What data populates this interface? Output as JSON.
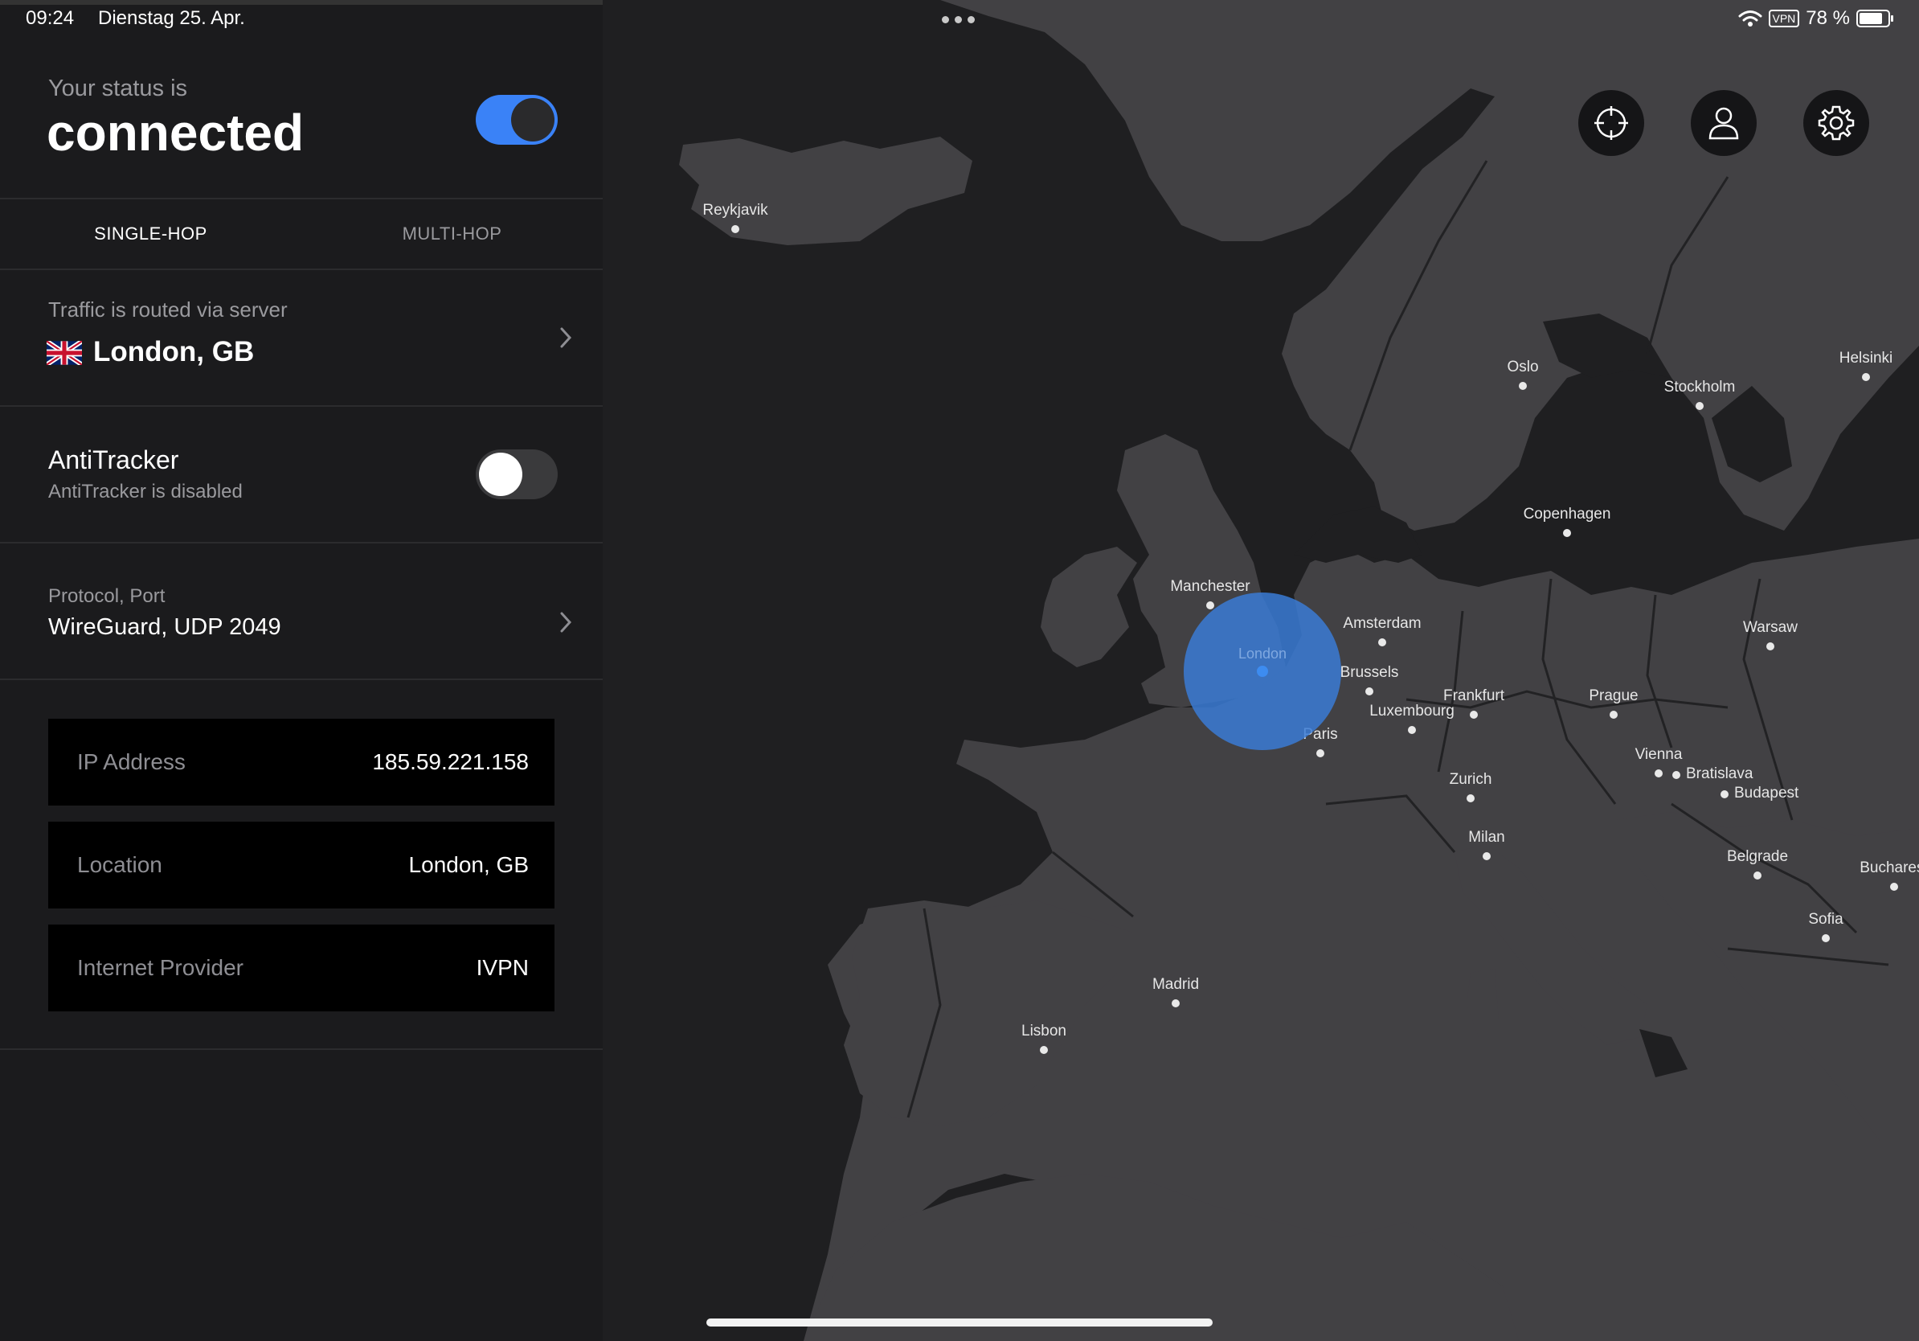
{
  "status_bar": {
    "time": "09:24",
    "date": "Dienstag 25. Apr.",
    "vpn": "VPN",
    "battery": "78 %",
    "icons": [
      "wifi-icon",
      "vpn-badge",
      "battery-icon"
    ]
  },
  "header": {
    "status_label": "Your status is",
    "status_value": "connected",
    "connection_toggle": "on"
  },
  "tabs": [
    {
      "label": "SINGLE-HOP",
      "selected": true
    },
    {
      "label": "MULTI-HOP",
      "selected": false
    }
  ],
  "server": {
    "label": "Traffic is routed via server",
    "value": "London, GB",
    "flag": "uk-flag-icon"
  },
  "antitracker": {
    "title": "AntiTracker",
    "subtitle": "AntiTracker is disabled",
    "toggle": "off"
  },
  "protocol": {
    "label": "Protocol, Port",
    "value": "WireGuard, UDP 2049"
  },
  "info": [
    {
      "key": "IP Address",
      "value": "185.59.221.158"
    },
    {
      "key": "Location",
      "value": "London, GB"
    },
    {
      "key": "Internet Provider",
      "value": "IVPN"
    }
  ],
  "map": {
    "selected_city": "London",
    "cities": [
      "Reykjavik",
      "Oslo",
      "Stockholm",
      "Helsinki",
      "Copenhagen",
      "Manchester",
      "Amsterdam",
      "Brussels",
      "Frankfurt",
      "Luxembourg",
      "Paris",
      "Prague",
      "Warsaw",
      "Vienna",
      "Bratislava",
      "Budapest",
      "Zurich",
      "Milan",
      "Belgrade",
      "Bucharest",
      "Sofia",
      "Madrid",
      "Lisbon"
    ],
    "buttons": [
      "locate-icon",
      "account-icon",
      "settings-icon"
    ],
    "colors": {
      "land": "#424144",
      "sea": "#1f1f21",
      "marker": "#3a7bd5",
      "accent": "#3a82f7"
    }
  }
}
